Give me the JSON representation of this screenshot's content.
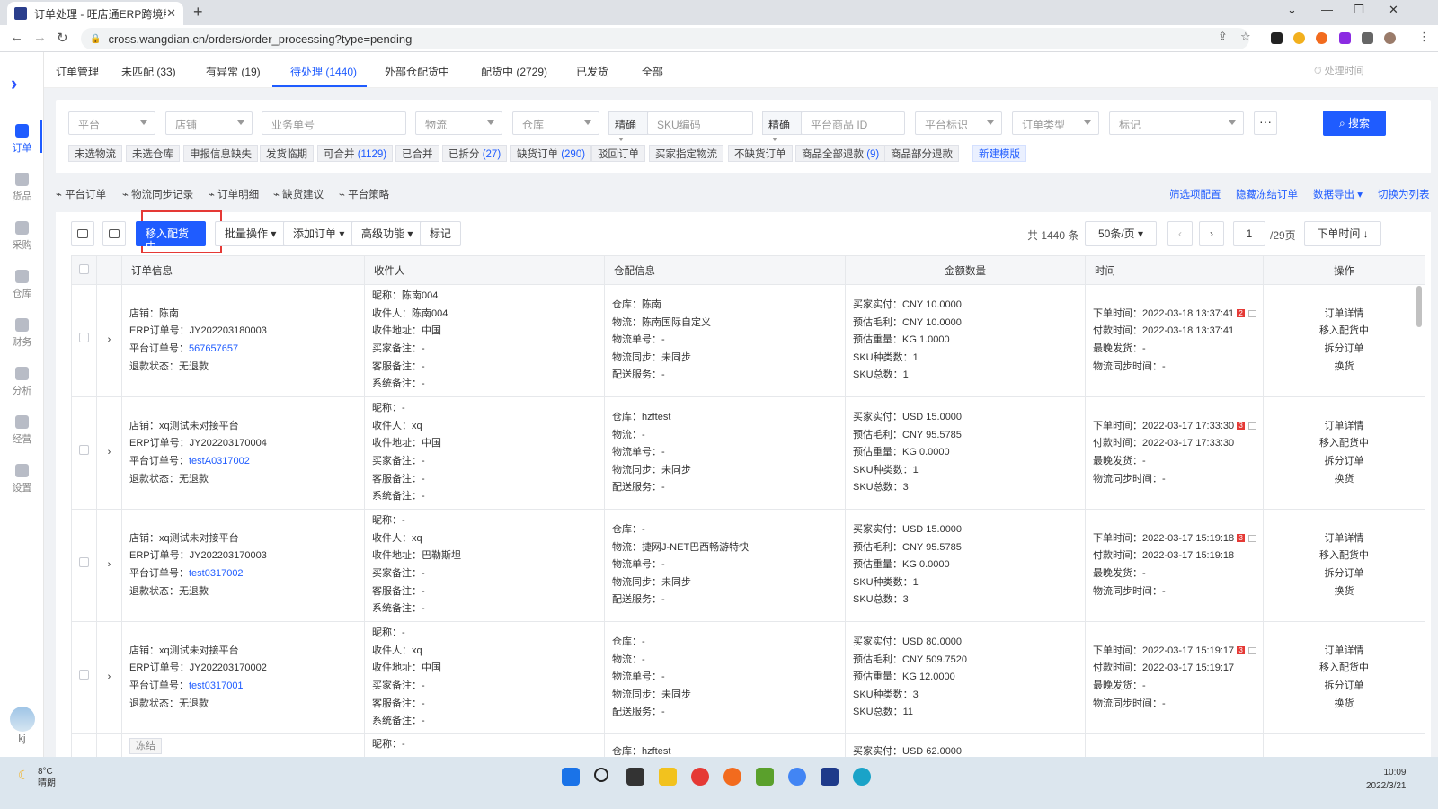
{
  "browser": {
    "tab_title": "订单处理 - 旺店通ERP跨境版",
    "url": "cross.wangdian.cn/orders/order_processing?type=pending"
  },
  "sidebar": {
    "items": [
      {
        "label": "订单",
        "icon": "order-icon"
      },
      {
        "label": "货品",
        "icon": "goods-icon"
      },
      {
        "label": "采购",
        "icon": "purchase-icon"
      },
      {
        "label": "仓库",
        "icon": "warehouse-icon"
      },
      {
        "label": "财务",
        "icon": "finance-icon"
      },
      {
        "label": "分析",
        "icon": "analysis-icon"
      },
      {
        "label": "经营",
        "icon": "operation-icon"
      },
      {
        "label": "设置",
        "icon": "settings-icon"
      }
    ],
    "user": "kj"
  },
  "header": {
    "title": "订单管理",
    "tabs": [
      "未匹配 (33)",
      "有异常 (19)",
      "待处理 (1440)",
      "外部仓配货中",
      "配货中 (2729)",
      "已发货",
      "全部"
    ],
    "time_button": "处理时间"
  },
  "filters": {
    "platform": "平台",
    "shop": "店铺",
    "business_no": "业务单号",
    "logistics": "物流",
    "warehouse": "仓库",
    "precise1": "精确",
    "sku_code": "SKU编码",
    "precise2": "精确",
    "platform_goods_id": "平台商品 ID",
    "platform_mark": "平台标识",
    "order_type": "订单类型",
    "mark": "标记",
    "more": "···",
    "search": "搜索"
  },
  "chips": [
    {
      "text": "未选物流",
      "count": ""
    },
    {
      "text": "未选仓库",
      "count": ""
    },
    {
      "text": "申报信息缺失",
      "count": ""
    },
    {
      "text": "发货临期",
      "count": ""
    },
    {
      "text": "可合并 ",
      "count": "(1129)"
    },
    {
      "text": "已合并",
      "count": ""
    },
    {
      "text": "已拆分 ",
      "count": "(27)"
    },
    {
      "text": "缺货订单 ",
      "count": "(290)"
    },
    {
      "text": "驳回订单",
      "count": ""
    },
    {
      "text": "买家指定物流",
      "count": ""
    },
    {
      "text": "不缺货订单",
      "count": ""
    },
    {
      "text": "商品全部退款 ",
      "count": "(9)"
    },
    {
      "text": "商品部分退款",
      "count": ""
    },
    {
      "text": "新建模版",
      "count": ""
    }
  ],
  "links_left": [
    "平台订单",
    "物流同步记录",
    "订单明细",
    "缺货建议",
    "平台策略"
  ],
  "links_right": [
    "筛选项配置",
    "隐藏冻结订单",
    "数据导出",
    "切换为列表"
  ],
  "toolbar": {
    "move_btn": "移入配货中",
    "batch": "批量操作",
    "add_order": "添加订单",
    "advanced": "高级功能",
    "mark": "标记",
    "total": "共 1440 条",
    "page_size": "50条/页",
    "page": "1",
    "pages": "/29页",
    "sort": "下单时间"
  },
  "columns": [
    "订单信息",
    "收件人",
    "仓配信息",
    "金额数量",
    "时间",
    "操作"
  ],
  "rows": [
    {
      "order": [
        "店铺：陈南",
        "ERP订单号：JY202203180003",
        "平台订单号：",
        "退款状态：无退款"
      ],
      "platform_no": "567657657",
      "recv": [
        "昵称：陈南004",
        "收件人：陈南004",
        "收件地址：中国",
        "买家备注：-",
        "客服备注：-",
        "系统备注：-"
      ],
      "wh": [
        "仓库：陈南",
        "物流：陈南国际自定义",
        "物流单号：-",
        "物流同步：未同步",
        "配送服务：-"
      ],
      "amt": [
        "买家实付：CNY 10.0000",
        "预估毛利：CNY 10.0000",
        "预估重量：KG 1.0000",
        "SKU种类数：1",
        "SKU总数：1"
      ],
      "time1": "下单时间：2022-03-18 13:37:41",
      "badge": "2",
      "time": [
        "付款时间：2022-03-18 13:37:41",
        "最晚发货：-",
        "物流同步时间：-"
      ]
    },
    {
      "order": [
        "店铺：xq测试未对接平台",
        "ERP订单号：JY202203170004",
        "平台订单号：",
        "退款状态：无退款"
      ],
      "platform_no": "testA0317002",
      "recv": [
        "昵称：-",
        "收件人：xq",
        "收件地址：中国",
        "买家备注：-",
        "客服备注：-",
        "系统备注：-"
      ],
      "wh": [
        "仓库：hzftest",
        "物流：-",
        "物流单号：-",
        "物流同步：未同步",
        "配送服务：-"
      ],
      "amt": [
        "买家实付：USD 15.0000",
        "预估毛利：CNY 95.5785",
        "预估重量：KG 0.0000",
        "SKU种类数：1",
        "SKU总数：3"
      ],
      "time1": "下单时间：2022-03-17 17:33:30",
      "badge": "3",
      "time": [
        "付款时间：2022-03-17 17:33:30",
        "最晚发货：-",
        "物流同步时间：-"
      ]
    },
    {
      "order": [
        "店铺：xq测试未对接平台",
        "ERP订单号：JY202203170003",
        "平台订单号：",
        "退款状态：无退款"
      ],
      "platform_no": "test0317002",
      "recv": [
        "昵称：-",
        "收件人：xq",
        "收件地址：巴勒斯坦",
        "买家备注：-",
        "客服备注：-",
        "系统备注：-"
      ],
      "wh": [
        "仓库：-",
        "物流：捷网J-NET巴西畅游特快",
        "物流单号：-",
        "物流同步：未同步",
        "配送服务：-"
      ],
      "amt": [
        "买家实付：USD 15.0000",
        "预估毛利：CNY 95.5785",
        "预估重量：KG 0.0000",
        "SKU种类数：1",
        "SKU总数：3"
      ],
      "time1": "下单时间：2022-03-17 15:19:18",
      "badge": "3",
      "time": [
        "付款时间：2022-03-17 15:19:18",
        "最晚发货：-",
        "物流同步时间：-"
      ]
    },
    {
      "order": [
        "店铺：xq测试未对接平台",
        "ERP订单号：JY202203170002",
        "平台订单号：",
        "退款状态：无退款"
      ],
      "platform_no": "test0317001",
      "recv": [
        "昵称：-",
        "收件人：xq",
        "收件地址：中国",
        "买家备注：-",
        "客服备注：-",
        "系统备注：-"
      ],
      "wh": [
        "仓库：-",
        "物流：-",
        "物流单号：-",
        "物流同步：未同步",
        "配送服务：-"
      ],
      "amt": [
        "买家实付：USD 80.0000",
        "预估毛利：CNY 509.7520",
        "预估重量：KG 12.0000",
        "SKU种类数：3",
        "SKU总数：11"
      ],
      "time1": "下单时间：2022-03-17 15:19:17",
      "badge": "3",
      "time": [
        "付款时间：2022-03-17 15:19:17",
        "最晚发货：-",
        "物流同步时间：-"
      ]
    }
  ],
  "partial_row": {
    "frozen": "冻结",
    "recv": "昵称：-",
    "wh": "仓库：hzftest",
    "amt": "买家实付：USD 62.0000"
  },
  "ops": [
    "订单详情",
    "移入配货中",
    "拆分订单",
    "换货"
  ],
  "taskbar": {
    "temp": "8°C",
    "weather": "晴朗",
    "time": "10:09",
    "date": "2022/3/21"
  }
}
